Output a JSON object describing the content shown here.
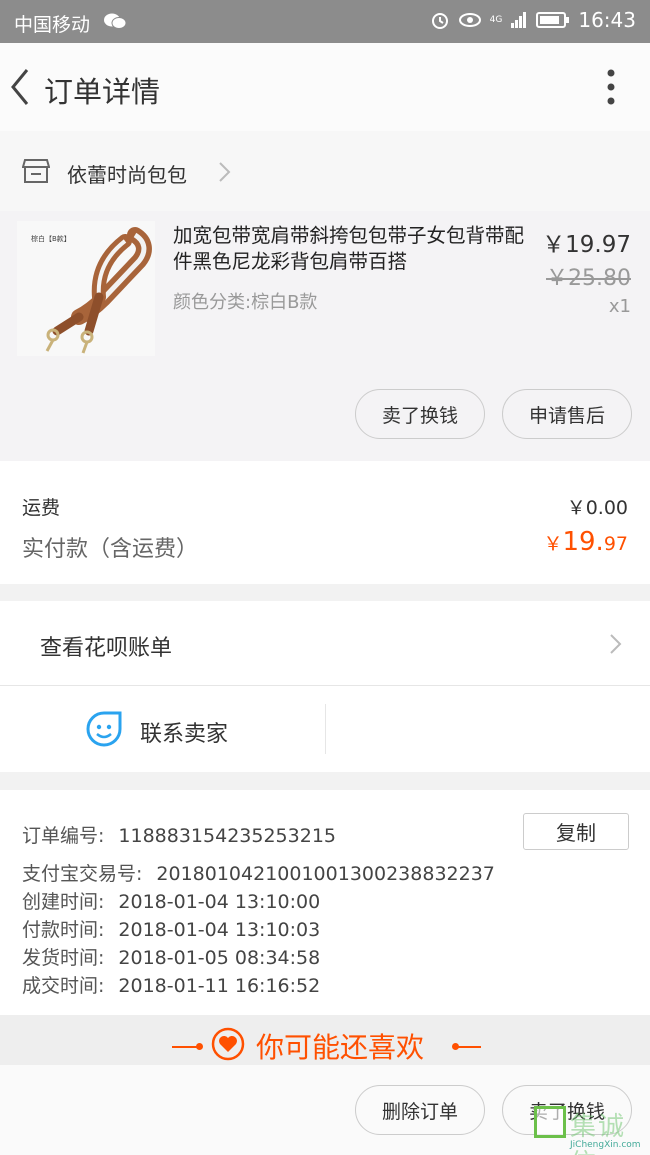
{
  "status_bar": {
    "carrier": "中国移动",
    "network": "4G",
    "time": "16:43"
  },
  "nav": {
    "title": "订单详情"
  },
  "shop": {
    "name": "依蕾时尚包包"
  },
  "item": {
    "thumb_tag": "棕白【B款】",
    "name": "加宽包带宽肩带斜挎包包带子女包背带配件黑色尼龙彩背包肩带百搭",
    "spec": "颜色分类:棕白B款",
    "price": "￥19.97",
    "original_price": "￥25.80",
    "quantity": "x1",
    "sell_button": "卖了换钱",
    "after_sale_button": "申请售后"
  },
  "fees": {
    "shipping_label": "运费",
    "shipping_value": "￥0.00",
    "paid_label": "实付款（含运费）",
    "paid_symbol": "￥",
    "paid_int": "19.",
    "paid_dec": "97"
  },
  "huabei": {
    "label": "查看花呗账单"
  },
  "contact": {
    "label": "联系卖家"
  },
  "order_info": {
    "copy_button": "复制",
    "rows": [
      {
        "key": "订单编号:",
        "value": "118883154235253215"
      },
      {
        "key": "支付宝交易号:",
        "value": "2018010421001001300238832237"
      },
      {
        "key": "创建时间:",
        "value": "2018-01-04 13:10:00"
      },
      {
        "key": "付款时间:",
        "value": "2018-01-04 13:10:03"
      },
      {
        "key": "发货时间:",
        "value": "2018-01-05 08:34:58"
      },
      {
        "key": "成交时间:",
        "value": "2018-01-11 16:16:52"
      }
    ]
  },
  "recommend": {
    "label": "你可能还喜欢"
  },
  "bottom_bar": {
    "delete_button": "删除订单",
    "sell_button": "卖了换钱"
  },
  "watermark": {
    "text": "集诚信",
    "url": "JiChengXin.com"
  },
  "colors": {
    "accent": "#ff5000",
    "status_bar": "#8c8c8c",
    "seller_icon": "#2aa3ef",
    "watermark_green": "#6cc04a"
  }
}
